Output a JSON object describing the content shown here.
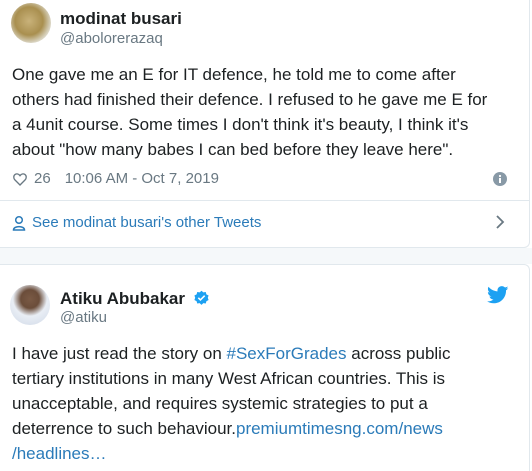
{
  "tweet1": {
    "author_name": "modinat busari",
    "author_handle": "@abolorerazaq",
    "text_lines": [
      "One gave me an E for IT defence, he told me to come after",
      "others had finished their defence.  I refused to he gave me E for",
      "a 4unit course. Some times I don't think it's beauty, I think it's",
      "about \"how many babes I can bed before they leave here\"."
    ],
    "likes": "26",
    "timestamp": "10:06 AM - Oct 7, 2019",
    "see_more": "See modinat busari's other Tweets"
  },
  "tweet2": {
    "author_name": "Atiku Abubakar",
    "author_handle": "@atiku",
    "line1_pre": "I have just read the story on ",
    "line1_hashtag": "#SexForGrades",
    "line1_post": " across public",
    "line2": "tertiary institutions in many West African countries. This is",
    "line3": "unacceptable, and requires systemic strategies to put a",
    "line4_pre": "deterrence to such behaviour.",
    "line4_link": "premiumtimesng.com/news",
    "line5_link": "/headlines…"
  },
  "colors": {
    "link": "#2b7bb9",
    "text": "#1c2022",
    "muted": "#697882",
    "twitter_blue": "#1da1f2",
    "verified_blue": "#1da1f2",
    "gap_background": "#f5f8fa"
  },
  "icons": {
    "like": "heart-icon",
    "info": "info-icon",
    "see_more": "person-icon",
    "chevron": "chevron-right-icon",
    "verified": "verified-badge-icon",
    "brand": "twitter-bird-icon"
  }
}
